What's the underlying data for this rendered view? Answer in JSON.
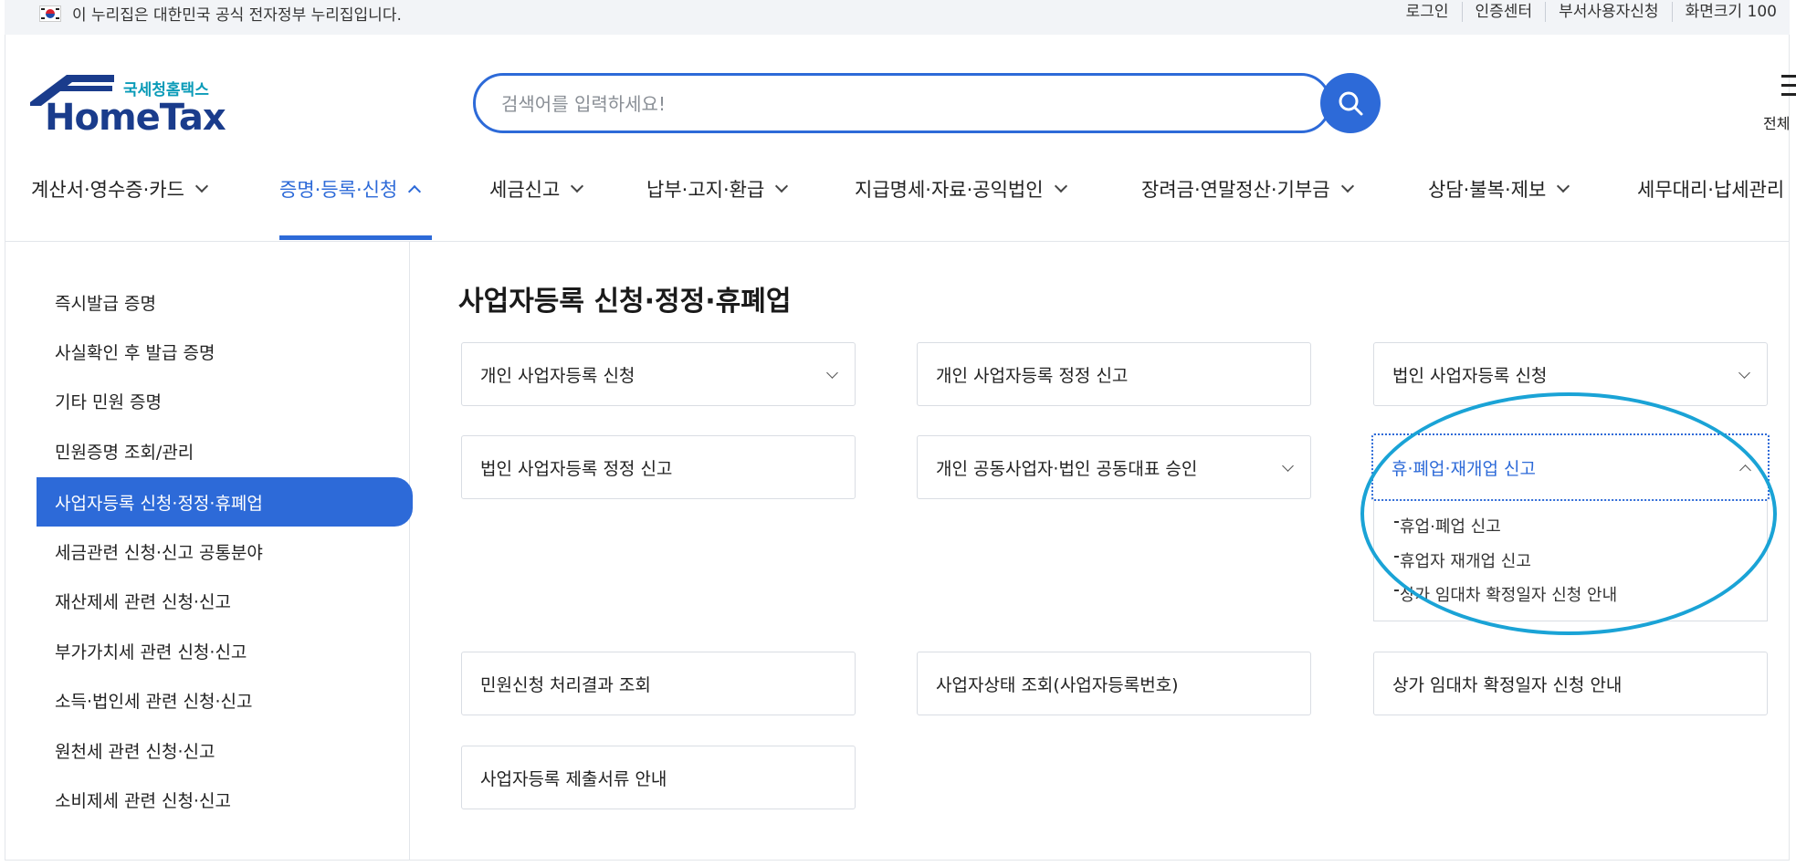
{
  "govbar": {
    "notice": "이 누리집은 대한민국 공식 전자정부 누리집입니다.",
    "links": [
      "로그인",
      "인증센터",
      "부서사용자신청",
      "화면크기 100"
    ]
  },
  "logo": {
    "sub": "국세청홈택스",
    "main": "HomeTax"
  },
  "search": {
    "placeholder": "검색어를 입력하세요!",
    "value": ""
  },
  "allmenu": {
    "label": "전체"
  },
  "gnb": {
    "items": [
      "계산서·영수증·카드",
      "증명·등록·신청",
      "세금신고",
      "납부·고지·환급",
      "지급명세·자료·공익법인",
      "장려금·연말정산·기부금",
      "상담·불복·제보",
      "세무대리·납세관리"
    ],
    "active_index": 1
  },
  "sidebar": {
    "items": [
      "즉시발급 증명",
      "사실확인 후 발급 증명",
      "기타 민원 증명",
      "민원증명 조회/관리",
      "사업자등록 신청·정정·휴폐업",
      "세금관련 신청·신고 공통분야",
      "재산제세 관련 신청·신고",
      "부가가치세 관련 신청·신고",
      "소득·법인세 관련 신청·신고",
      "원천세 관련 신청·신고",
      "소비제세 관련 신청·신고"
    ],
    "active_index": 4
  },
  "main": {
    "title": "사업자등록 신청·정정·휴폐업",
    "cards": [
      "개인 사업자등록 신청",
      "개인 사업자등록 정정 신고",
      "법인 사업자등록 신청",
      "법인 사업자등록 정정 신고",
      "개인 공동사업자·법인 공동대표 승인",
      "휴·폐업·재개업 신고",
      "민원신청 처리결과 조회",
      "사업자상태 조회(사업자등록번호)",
      "상가 임대차 확정일자 신청 안내",
      "사업자등록 제출서류 안내"
    ],
    "open_card_sub": [
      "휴업·폐업 신고",
      "휴업자 재개업 신고",
      "상가 임대차 확정일자 신청 안내"
    ]
  },
  "colors": {
    "accent": "#2d6ad8",
    "highlight": "#1aa3d6",
    "brand_navy": "#1a3c8c",
    "brand_teal": "#0a9bb8"
  },
  "icons": [
    "korea-flag-icon",
    "search-icon",
    "hamburger-menu-icon",
    "chevron-down-icon",
    "chevron-up-icon"
  ]
}
